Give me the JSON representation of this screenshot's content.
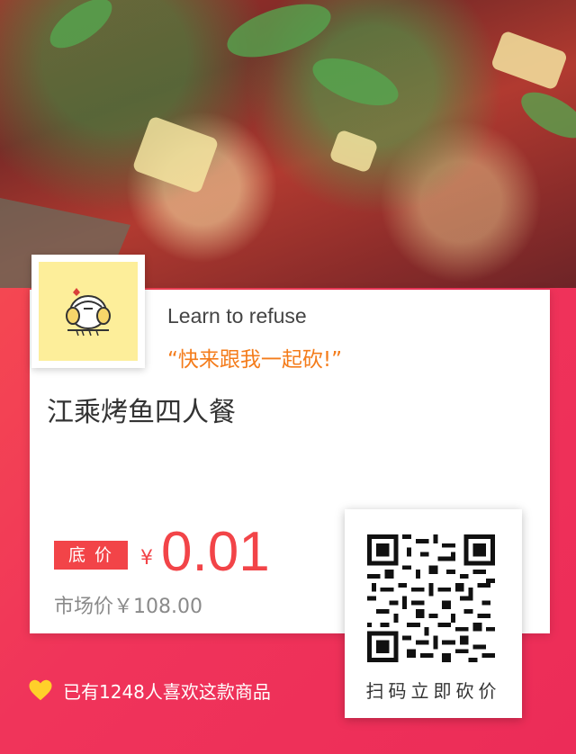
{
  "hero": {
    "image": "grilled-fish-photo"
  },
  "user": {
    "name": "Learn to refuse",
    "slogan": "“快来跟我一起砍!”",
    "avatar_icon": "cartoon-avatar-icon"
  },
  "product": {
    "title": "江乘烤鱼四人餐",
    "price_badge": "底价",
    "currency": "¥",
    "price": "0.01",
    "market_price": "市场价￥108.00"
  },
  "qr": {
    "caption": "扫码立即砍价",
    "icon": "qr-code-icon"
  },
  "footer": {
    "likes_text": "已有1248人喜欢这款商品",
    "heart_icon": "heart-icon"
  },
  "colors": {
    "accent": "#f24448",
    "slogan": "#f47c1b",
    "avatar_bg": "#fdee9a",
    "heart": "#ffd02a"
  }
}
